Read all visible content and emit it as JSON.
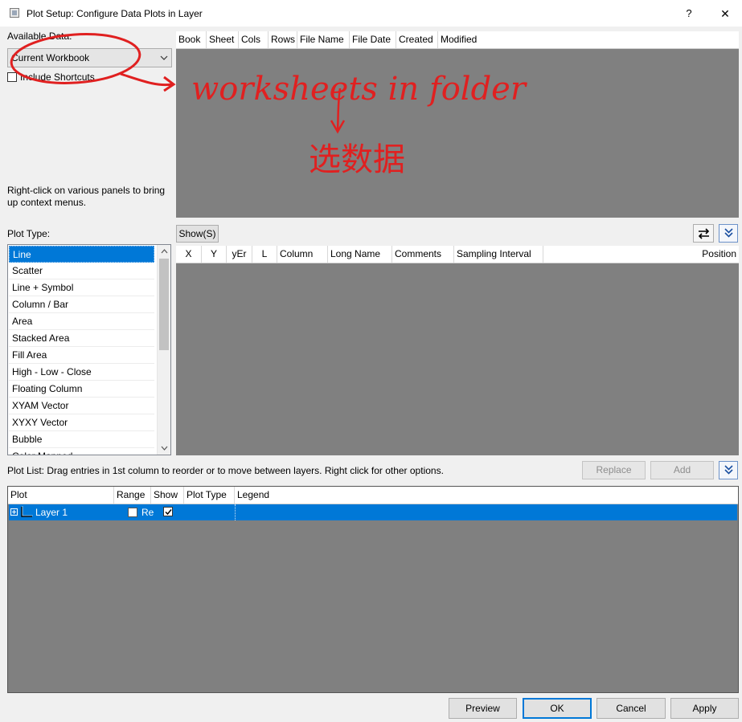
{
  "window": {
    "title": "Plot Setup: Configure Data Plots in Layer",
    "help_label": "?",
    "close_label": "✕"
  },
  "available_data": {
    "label": "Available Data:",
    "selected": "Current Workbook",
    "include_shortcuts_label": "Include Shortcuts",
    "include_shortcuts_checked": false
  },
  "hint_text": "Right-click on various panels to bring up context menus.",
  "book_table": {
    "columns": [
      "Book",
      "Sheet",
      "Cols",
      "Rows",
      "File Name",
      "File Date",
      "Created",
      "Modified"
    ]
  },
  "annotation": {
    "text": "worksheets in folder",
    "text2": "选数据",
    "color": "#e02020"
  },
  "plot_type": {
    "label": "Plot Type:",
    "items": [
      "Line",
      "Scatter",
      "Line + Symbol",
      "Column / Bar",
      "Area",
      "Stacked Area",
      "Fill Area",
      "High - Low - Close",
      "Floating Column",
      "XYAM Vector",
      "XYXY Vector",
      "Bubble",
      "Color Mapped"
    ],
    "selected_index": 0
  },
  "show_button": "Show(S)",
  "column_table": {
    "columns": [
      "X",
      "Y",
      "yEr",
      "L",
      "Column",
      "Long Name",
      "Comments",
      "Sampling Interval"
    ],
    "position_label": "Position"
  },
  "plot_list": {
    "description": "Plot List: Drag entries in 1st column to reorder or to move between layers. Right click for other options.",
    "replace_label": "Replace",
    "add_label": "Add",
    "columns": [
      "Plot",
      "Range",
      "Show",
      "Plot Type",
      "Legend"
    ],
    "rows": [
      {
        "plot": "Layer 1",
        "range": "Re",
        "range_checked": false,
        "show_checked": true
      }
    ]
  },
  "footer": {
    "preview": "Preview",
    "ok": "OK",
    "cancel": "Cancel",
    "apply": "Apply"
  },
  "colors": {
    "selection": "#0078d7",
    "panel": "#808080"
  }
}
